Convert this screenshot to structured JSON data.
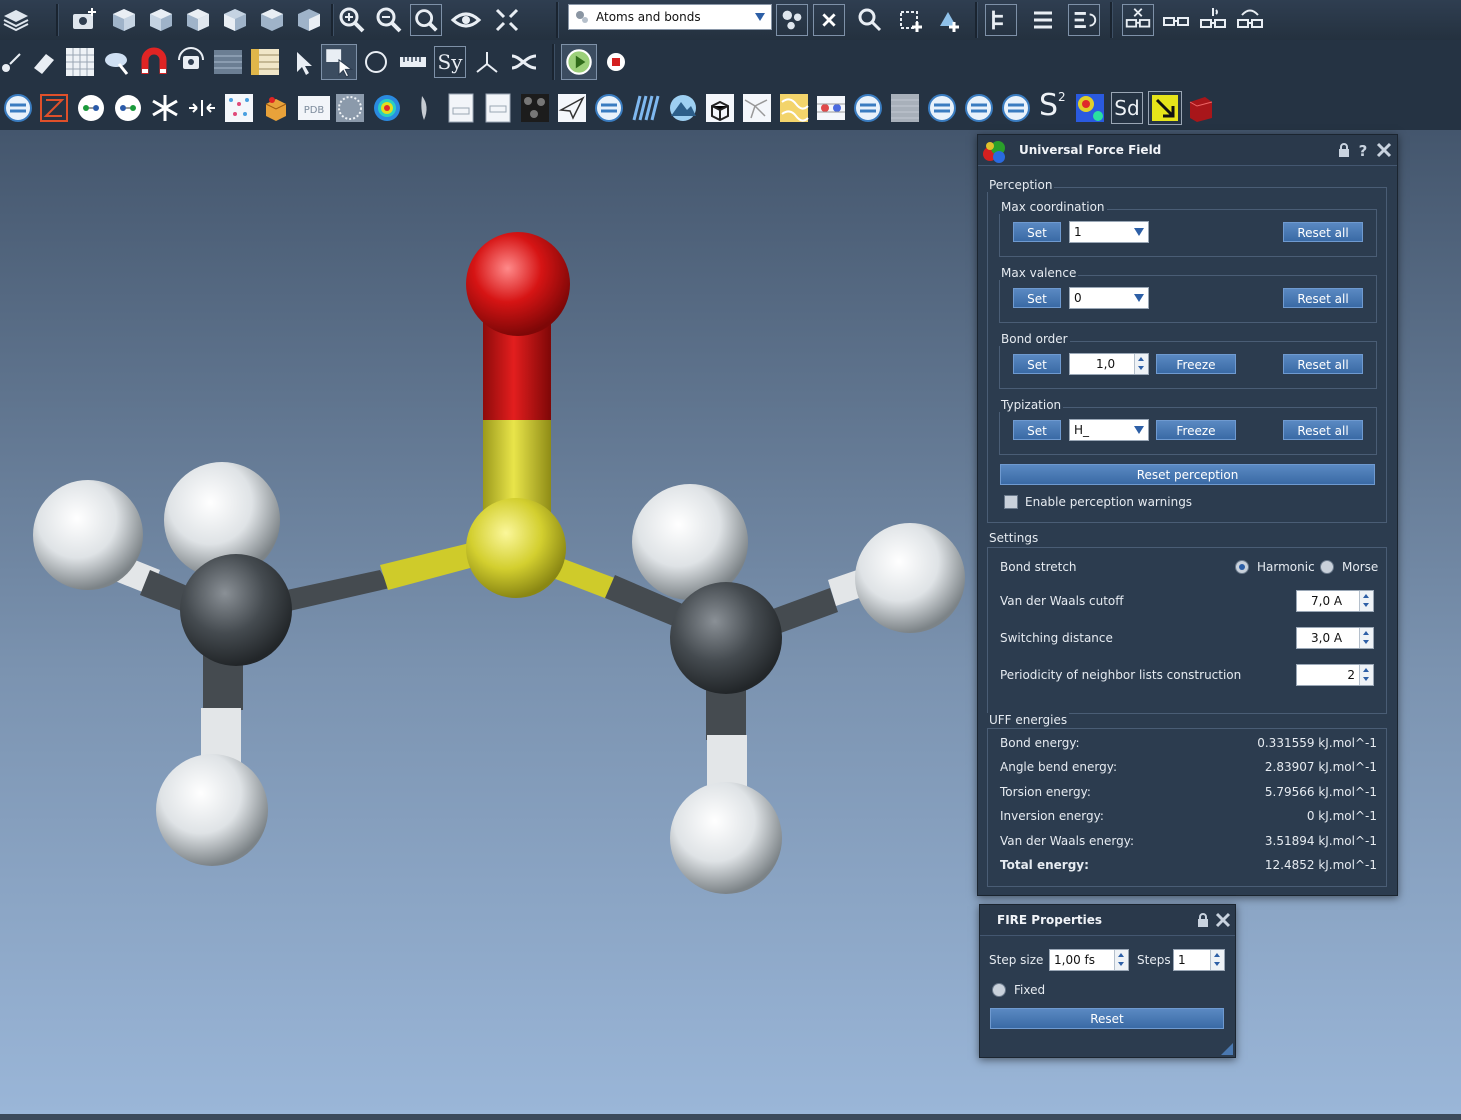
{
  "toolbar": {
    "row1_icons": [
      "layers-icon",
      "camera-add-icon",
      "cube-view-icon",
      "cube-view-icon",
      "cube-view-icon",
      "cube-view-icon",
      "cube-view-icon",
      "cube-view-icon",
      "zoom-in-icon",
      "zoom-out-icon",
      "zoom-fit-icon",
      "eye-icon",
      "fit-arrows-icon"
    ],
    "display_mode": "Atoms and bonds",
    "row1_right_icons": [
      "select-atoms-icon",
      "close-selection-icon",
      "search-icon",
      "add-atoms-icon",
      "add-fragment-icon",
      "tree-view-icon",
      "list-view-icon",
      "list-refresh-icon",
      "glasses-close-icon",
      "glasses-icon",
      "glasses-sound-icon",
      "glasses-rotate-icon"
    ],
    "row2_icons": [
      "atom-tool-icon",
      "eraser-icon",
      "lattice-icon",
      "cloud-arrow-icon",
      "magnet-icon",
      "rotate-camera-icon",
      "surface-icon",
      "measure-grid-icon",
      "pointer-icon",
      "select-box-icon",
      "rotate-icon",
      "ruler-icon",
      "symmetry-icon",
      "axes-icon",
      "shuffle-icon",
      "play-icon",
      "stop-icon"
    ],
    "symmetry_label": "Sy",
    "row3_icons": [
      "plugin-icon",
      "builder-icon",
      "molecule-icon",
      "molecule-icon",
      "snowflake-icon",
      "compress-icon",
      "crystal-icon",
      "box-icon",
      "pdb-icon",
      "nanotube-icon",
      "spectrum-icon",
      "feather-icon",
      "document-icon",
      "document-icon",
      "porous-icon",
      "plane-icon",
      "plugin-icon",
      "waves-icon",
      "mountain-icon",
      "element-cube-icon",
      "network-icon",
      "gold-surface-icon",
      "grid-pattern-icon",
      "plugin-icon",
      "noise-icon",
      "plugin-icon",
      "plugin-icon",
      "plugin-icon",
      "s2-icon",
      "heatmap-icon",
      "sd-icon",
      "arrow-box-icon",
      "book-icon"
    ],
    "pdb_label": "PDB",
    "s2_label": "S",
    "s2_sup": "2",
    "sd_label": "Sd"
  },
  "uff_panel": {
    "title": "Universal Force Field",
    "icons": [
      "lock-icon",
      "help-icon",
      "close-icon"
    ],
    "perception": {
      "label": "Perception",
      "max_coordination": {
        "label": "Max coordination",
        "set": "Set",
        "value": "1",
        "reset": "Reset all"
      },
      "max_valence": {
        "label": "Max valence",
        "set": "Set",
        "value": "0",
        "reset": "Reset all"
      },
      "bond_order": {
        "label": "Bond order",
        "set": "Set",
        "value": "1,0",
        "freeze": "Freeze",
        "reset": "Reset all"
      },
      "typization": {
        "label": "Typization",
        "set": "Set",
        "value": "H_",
        "freeze": "Freeze",
        "reset": "Reset all"
      },
      "reset_perception": "Reset  perception",
      "warnings": "Enable perception warnings"
    },
    "settings": {
      "label": "Settings",
      "bond_stretch": "Bond stretch",
      "harmonic": "Harmonic",
      "morse": "Morse",
      "vdw_cutoff_label": "Van der Waals cutoff",
      "vdw_cutoff": "7,0 A",
      "switching_label": "Switching distance",
      "switching": "3,0 A",
      "periodicity_label": "Periodicity of neighbor lists construction",
      "periodicity": "2"
    },
    "energies": {
      "label": "UFF energies",
      "rows": [
        {
          "name": "Bond energy:",
          "value": "0.331559 kJ.mol^-1"
        },
        {
          "name": "Angle bend energy:",
          "value": "2.83907 kJ.mol^-1"
        },
        {
          "name": "Torsion energy:",
          "value": "5.79566 kJ.mol^-1"
        },
        {
          "name": "Inversion energy:",
          "value": "0 kJ.mol^-1"
        },
        {
          "name": "Van der Waals energy:",
          "value": "3.51894 kJ.mol^-1"
        },
        {
          "name": "Total energy:",
          "value": "12.4852 kJ.mol^-1"
        }
      ]
    }
  },
  "fire_panel": {
    "title": "FIRE Properties",
    "step_size_label": "Step size",
    "step_size": "1,00 fs",
    "steps_label": "Steps",
    "steps": "1",
    "fixed": "Fixed",
    "reset": "Reset"
  },
  "colors": {
    "oxygen": "#d11a1a",
    "sulfur": "#d6d23a",
    "carbon": "#4a4f54",
    "hydrogen": "#e8ecef",
    "accent": "#3a6aa5"
  }
}
